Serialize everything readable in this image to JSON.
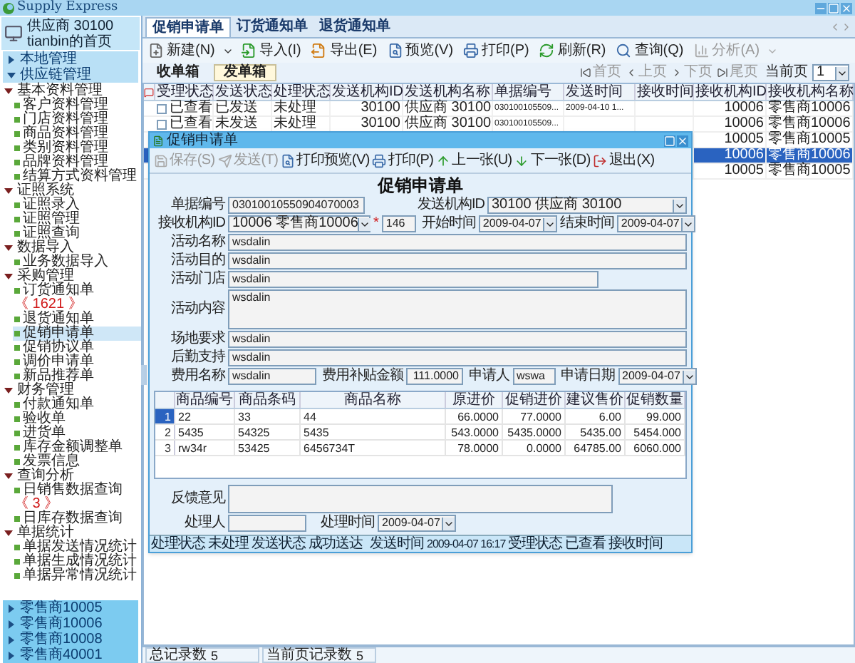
{
  "app_title": "Supply Express",
  "sidebar": {
    "account": {
      "name": "供应商 30100",
      "home": "tianbin的首页"
    },
    "sections": [
      {
        "label": "本地管理",
        "expanded": false
      },
      {
        "label": "供应链管理",
        "expanded": true
      }
    ],
    "tree": [
      {
        "label": "基本资料管理",
        "expanded": true,
        "children": [
          {
            "label": "客户资料管理",
            "selected": false
          },
          {
            "label": "门店资料管理",
            "selected": false
          },
          {
            "label": "商品资料管理",
            "selected": false
          },
          {
            "label": "类别资料管理",
            "selected": false
          },
          {
            "label": "品牌资料管理",
            "selected": false
          },
          {
            "label": "结算方式资料管理",
            "selected": false
          }
        ]
      },
      {
        "label": "证照系统",
        "expanded": true,
        "children": [
          {
            "label": "证照录入",
            "selected": false
          },
          {
            "label": "证照管理",
            "selected": false
          },
          {
            "label": "证照查询",
            "selected": false
          }
        ]
      },
      {
        "label": "数据导入",
        "expanded": true,
        "children": [
          {
            "label": "业务数据导入",
            "selected": false
          }
        ]
      },
      {
        "label": "采购管理",
        "expanded": true,
        "children": [
          {
            "label": "订货通知单",
            "badge": "《 1621 》",
            "selected": false
          },
          {
            "label": "退货通知单",
            "selected": false
          },
          {
            "label": "促销申请单",
            "selected": true
          },
          {
            "label": "促销协议单",
            "selected": false
          },
          {
            "label": "调价申请单",
            "selected": false
          },
          {
            "label": "新品推荐单",
            "selected": false
          }
        ]
      },
      {
        "label": "财务管理",
        "expanded": true,
        "children": [
          {
            "label": "付款通知单",
            "selected": false
          },
          {
            "label": "验收单",
            "selected": false
          },
          {
            "label": "进货单",
            "selected": false
          },
          {
            "label": "库存金额调整单",
            "selected": false
          },
          {
            "label": "发票信息",
            "selected": false
          }
        ]
      },
      {
        "label": "查询分析",
        "expanded": true,
        "children": [
          {
            "label": "日销售数据查询",
            "badge": "《 3 》",
            "selected": false
          },
          {
            "label": "日库存数据查询",
            "selected": false
          }
        ]
      },
      {
        "label": "单据统计",
        "expanded": true,
        "children": [
          {
            "label": "单据发送情况统计",
            "selected": false
          },
          {
            "label": "单据生成情况统计",
            "selected": false
          },
          {
            "label": "单据异常情况统计",
            "selected": false
          }
        ]
      }
    ],
    "bottom_sections": [
      {
        "label": "零售商10005",
        "expanded": false
      },
      {
        "label": "零售商10006",
        "expanded": false
      },
      {
        "label": "零售商10008",
        "expanded": false
      },
      {
        "label": "零售商40001",
        "expanded": false
      }
    ]
  },
  "tabs": [
    {
      "label": "促销申请单",
      "selected": true
    },
    {
      "label": "订货通知单",
      "selected": false
    },
    {
      "label": "退货通知单",
      "selected": false
    }
  ],
  "toolbar": [
    {
      "label": "新建(N)",
      "menu": true,
      "disabled": false
    },
    {
      "label": "导入(I)",
      "menu": false,
      "disabled": false
    },
    {
      "label": "导出(E)",
      "menu": false,
      "disabled": false
    },
    {
      "label": "预览(V)",
      "menu": false,
      "disabled": false
    },
    {
      "label": "打印(P)",
      "menu": false,
      "disabled": false
    },
    {
      "label": "刷新(R)",
      "menu": false,
      "disabled": false
    },
    {
      "label": "查询(Q)",
      "menu": false,
      "disabled": false
    },
    {
      "label": "分析(A)",
      "menu": true,
      "disabled": true
    }
  ],
  "boxes": [
    {
      "label": "收单箱",
      "selected": false
    },
    {
      "label": "发单箱",
      "selected": true
    }
  ],
  "pager": {
    "buttons": [
      {
        "label": "首页",
        "disabled": true
      },
      {
        "label": "上页",
        "disabled": true
      },
      {
        "label": "下页",
        "disabled": true
      },
      {
        "label": "尾页",
        "disabled": true
      }
    ],
    "page_label": "当前页",
    "page": "1"
  },
  "table": {
    "columns": [
      "受理状态",
      "发送状态",
      "处理状态",
      "发送机构ID",
      "发送机构名称",
      "单据编号",
      "发送时间",
      "接收时间",
      "接收机构ID",
      "接收机构名称"
    ],
    "rows": [
      {
        "selected": false,
        "checked": false,
        "cells": [
          "已查看",
          "已发送",
          "未处理",
          "30100",
          "供应商 30100",
          "030100105509...",
          "2009-04-10 1...",
          null,
          "10006",
          "零售商10006"
        ]
      },
      {
        "selected": false,
        "checked": false,
        "cells": [
          "已查看",
          "未发送",
          "未处理",
          "30100",
          "供应商 30100",
          "030100105509...",
          null,
          null,
          "10006",
          "零售商10006"
        ]
      },
      {
        "selected": false,
        "cells": [
          "10005",
          "零售商10005"
        ]
      },
      {
        "selected": true,
        "cells": [
          "10006",
          "零售商10006"
        ]
      },
      {
        "selected": false,
        "cells": [
          "10005",
          "零售商10005"
        ]
      }
    ]
  },
  "dialog": {
    "title": "促销申请单",
    "toolbar": [
      {
        "label": "保存(S)",
        "disabled": true
      },
      {
        "label": "发送(T)",
        "disabled": true
      },
      {
        "label": "打印预览(V)",
        "disabled": false
      },
      {
        "label": "打印(P)",
        "disabled": false
      },
      {
        "label": "上一张(U)",
        "disabled": false
      },
      {
        "label": "下一张(D)",
        "disabled": false
      },
      {
        "label": "退出(X)",
        "disabled": false
      }
    ],
    "heading": "促销申请单",
    "doc_no": {
      "label": "单据编号",
      "value": "03010010550904070003"
    },
    "sender": {
      "label": "发送机构ID",
      "value": "30100 供应商 30100"
    },
    "receiver": {
      "label": "接收机构ID",
      "value": "10006 零售商10006",
      "required": "*",
      "extra": "146"
    },
    "start": {
      "label": "开始时间",
      "value": "2009-04-07"
    },
    "end": {
      "label": "结束时间",
      "value": "2009-04-07"
    },
    "fields": [
      {
        "label": "活动名称",
        "value": "wsdalin",
        "kind": "line"
      },
      {
        "label": "活动目的",
        "value": "wsdalin",
        "kind": "line"
      },
      {
        "label": "活动门店",
        "value": "wsdalin",
        "kind": "short"
      },
      {
        "label": "活动内容",
        "value": "wsdalin",
        "kind": "area"
      },
      {
        "label": "场地要求",
        "value": "wsdalin",
        "kind": "line"
      },
      {
        "label": "后勤支持",
        "value": "wsdalin",
        "kind": "line"
      }
    ],
    "cost_name": {
      "label": "费用名称",
      "value": "wsdalin"
    },
    "cost_amount": {
      "label": "费用补贴金额",
      "value": "111.0000"
    },
    "applicant": {
      "label": "申请人",
      "value": "wswa"
    },
    "apply_date": {
      "label": "申请日期",
      "value": "2009-04-07"
    },
    "items": {
      "columns": [
        "商品编号",
        "商品条码",
        "商品名称",
        "原进价",
        "促销进价",
        "建议售价",
        "促销数量"
      ],
      "rows": [
        {
          "num": "1",
          "selected": true,
          "cells": [
            "22",
            "33",
            "44",
            "66.0000",
            "77.0000",
            "6.00",
            "99.000"
          ]
        },
        {
          "num": "2",
          "selected": false,
          "cells": [
            "5435",
            "54325",
            "5435",
            "543.0000",
            "5435.0000",
            "5435.00",
            "5454.000"
          ]
        },
        {
          "num": "3",
          "selected": false,
          "cells": [
            "rw34r",
            "53425",
            "6456734T",
            "78.0000",
            "0.0000",
            "64785.00",
            "6060.000"
          ]
        }
      ]
    },
    "feedback": {
      "label": "反馈意见"
    },
    "handler": {
      "label": "处理人"
    },
    "handle_time": {
      "label": "处理时间",
      "value": "2009-04-07"
    },
    "status": [
      {
        "label": "处理状态",
        "value": "未处理"
      },
      {
        "label": "发送状态",
        "value": "成功送达"
      },
      {
        "label": "发送时间",
        "value": "2009-04-07 16:17"
      },
      {
        "label": "受理状态",
        "value": "已查看"
      },
      {
        "label": "接收时间"
      }
    ]
  },
  "status_bar": [
    {
      "label": "总记录数",
      "value": "5"
    },
    {
      "label": "当前页记录数",
      "value": "5"
    }
  ]
}
